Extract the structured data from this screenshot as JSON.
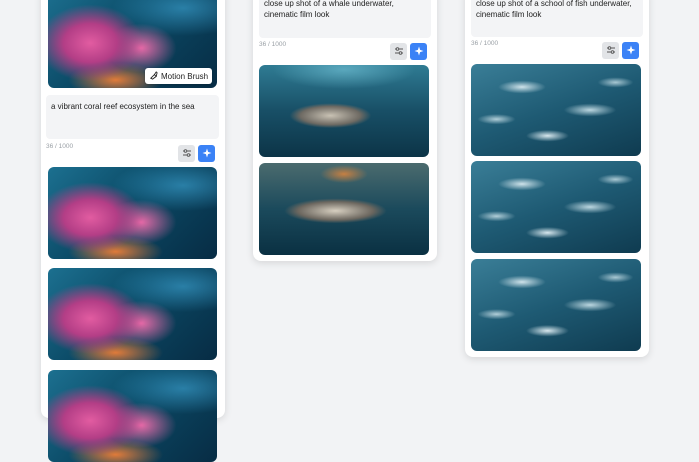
{
  "columns": [
    {
      "prompt": "a vibrant coral reef ecosystem in the sea",
      "char_count": "36 / 1000",
      "badge_label": "Motion Brush",
      "image_count": 4
    },
    {
      "prompt": "close up shot of a whale underwater, cinematic film look",
      "char_count": "36 / 1000",
      "image_count": 2
    },
    {
      "prompt": "close up shot of a school of fish underwater, cinematic film look",
      "char_count": "36 / 1000",
      "image_count": 3
    }
  ],
  "icons": {
    "settings": "sliders-icon",
    "generate": "sparkle-icon",
    "motion_brush": "brush-icon"
  },
  "colors": {
    "accent": "#3b82f6",
    "background": "#f2f3f5",
    "card": "#ffffff"
  }
}
